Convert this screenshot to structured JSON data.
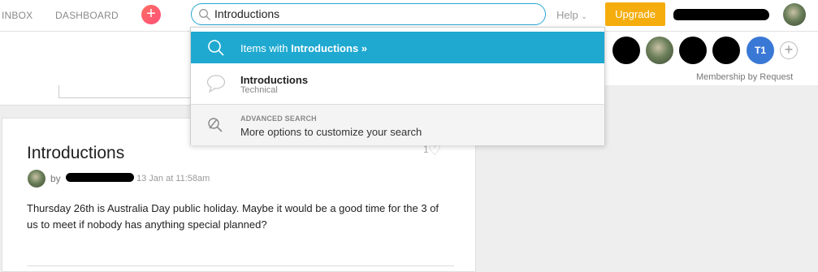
{
  "topbar": {
    "nav": [
      "INBOX",
      "DASHBOARD"
    ],
    "search_value": "Introductions",
    "help_label": "Help",
    "upgrade_label": "Upgrade"
  },
  "group": {
    "member_initials": "T1",
    "membership_label": "Membership by Request"
  },
  "dropdown": {
    "items_with_prefix": "Items with ",
    "items_with_term": "Introductions »",
    "result_title": "Introductions",
    "result_subtitle": "Technical",
    "advanced_label": "ADVANCED SEARCH",
    "advanced_text": "More options to customize your search"
  },
  "post": {
    "title": "Introductions",
    "like_count": "1",
    "by_label": "by",
    "date": "13 Jan at 11:58am",
    "body": "Thursday 26th is Australia Day public holiday. Maybe it would be a good time for the 3 of us to meet if nobody has anything special planned?"
  },
  "colors": {
    "accent": "#1fa9d1",
    "upgrade": "#f5ad0d",
    "member_badge": "#3a78d6"
  }
}
